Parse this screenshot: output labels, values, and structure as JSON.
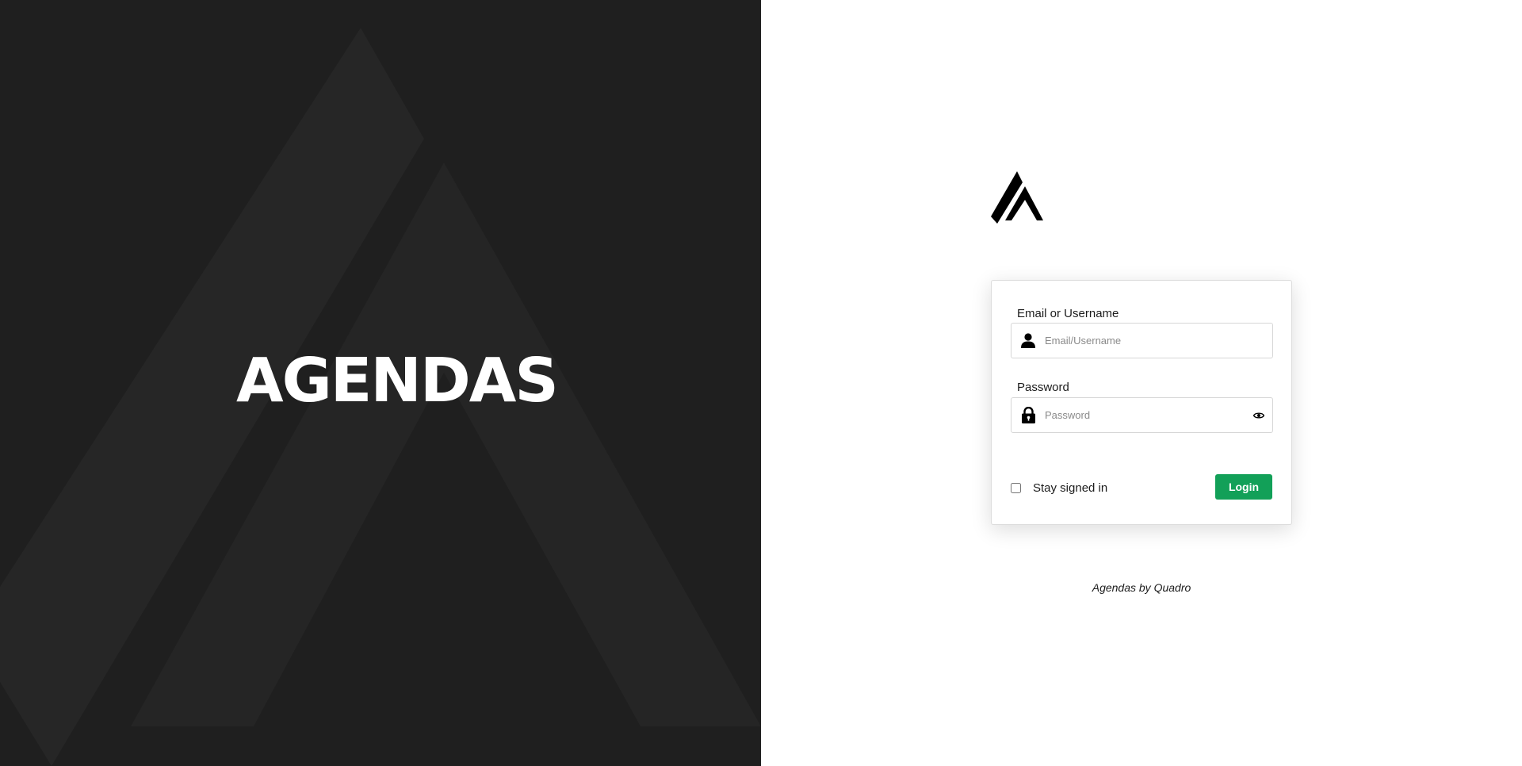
{
  "brand": {
    "title": "AGENDAS",
    "background_color": "#1f1f1f",
    "logo_icon": "agendas-a-logo"
  },
  "login": {
    "email_label": "Email or Username",
    "email_placeholder": "Email/Username",
    "email_value": "",
    "email_icon": "user-icon",
    "password_label": "Password",
    "password_placeholder": "Password",
    "password_value": "",
    "password_icon": "lock-icon",
    "password_toggle_icon": "eye-icon",
    "remember_label": "Stay signed in",
    "remember_checked": false,
    "submit_label": "Login",
    "submit_color": "#12a058"
  },
  "footer": {
    "credit": "Agendas by Quadro"
  }
}
